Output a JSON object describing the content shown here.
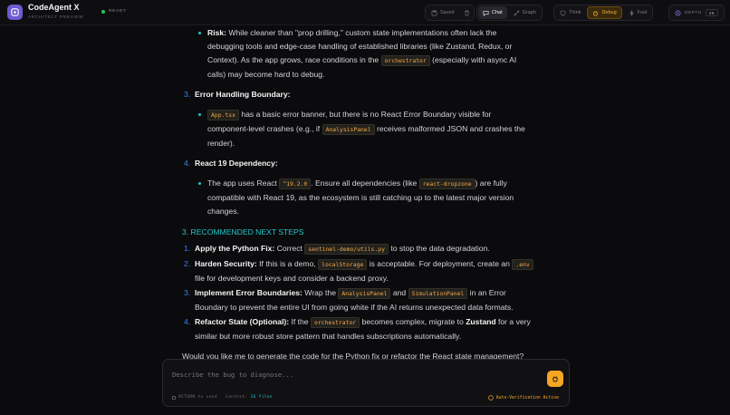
{
  "header": {
    "title": "CodeAgent X",
    "subtitle": "ARCHITECT PREVIEW",
    "status": "READY",
    "save_label": "Saved",
    "view_tabs": [
      "Chat",
      "Graph"
    ],
    "mode_tabs": [
      "Think",
      "Debug",
      "Fast"
    ],
    "depth_label": "DEPTH",
    "depth_value": "4K"
  },
  "content": {
    "risk": {
      "label": "Risk:",
      "t1": " While cleaner than \"prop drilling,\" custom state implementations often lack the debugging tools and edge-case handling of established libraries (like Zustand, Redux, or Context). As the app grows, race conditions in the ",
      "code1": "orchestrator",
      "t2": " (especially with async AI calls) may become hard to debug."
    },
    "item3": {
      "num": "3.",
      "title": "Error Handling Boundary:",
      "code1": "App.tsx",
      "t1": " has a basic error banner, but there is no React Error Boundary visible for component-level crashes (e.g., if ",
      "code2": "AnalysisPanel",
      "t2": " receives malformed JSON and crashes the render)."
    },
    "item4": {
      "num": "4.",
      "title": "React 19 Dependency:",
      "t1": "The app uses React ",
      "code1": "^19.2.0",
      "t2": ". Ensure all dependencies (like ",
      "code2": "react-dropzone",
      "t3": ") are fully compatible with React 19, as the ecosystem is still catching up to the latest major version changes."
    },
    "section_heading": "3. RECOMMENDED NEXT STEPS",
    "steps": {
      "s1": {
        "num": "1.",
        "title": "Apply the Python Fix:",
        "t1": " Correct ",
        "code1": "sentinel-demo/utils.py",
        "t2": " to stop the data degradation."
      },
      "s2": {
        "num": "2.",
        "title": "Harden Security:",
        "t1": " If this is a demo, ",
        "code1": "localStorage",
        "t2": " is acceptable. For deployment, create an ",
        "code2": ".env",
        "t3": " file for development keys and consider a backend proxy."
      },
      "s3": {
        "num": "3.",
        "title": "Implement Error Boundaries:",
        "t1": " Wrap the ",
        "code1": "AnalysisPanel",
        "t2": " and ",
        "code2": "SimulationPanel",
        "t3": " in an Error Boundary to prevent the entire UI from going white if the AI returns unexpected data formats."
      },
      "s4": {
        "num": "4.",
        "title": "Refactor State (Optional):",
        "t1": " If the ",
        "code1": "orchestrator",
        "t2": " becomes complex, migrate to ",
        "bold1": "Zustand",
        "t3": " for a very similar but more robust store pattern that handles subscriptions automatically."
      }
    },
    "closing": "Would you like me to generate the code for the Python fix or refactor the React state management?"
  },
  "composer": {
    "placeholder": "Describe the bug to diagnose...",
    "return_hint": "RETURN to send",
    "context_label": "Context:",
    "context_value": "16 files",
    "auto_verify": "Auto-Verification Active"
  }
}
